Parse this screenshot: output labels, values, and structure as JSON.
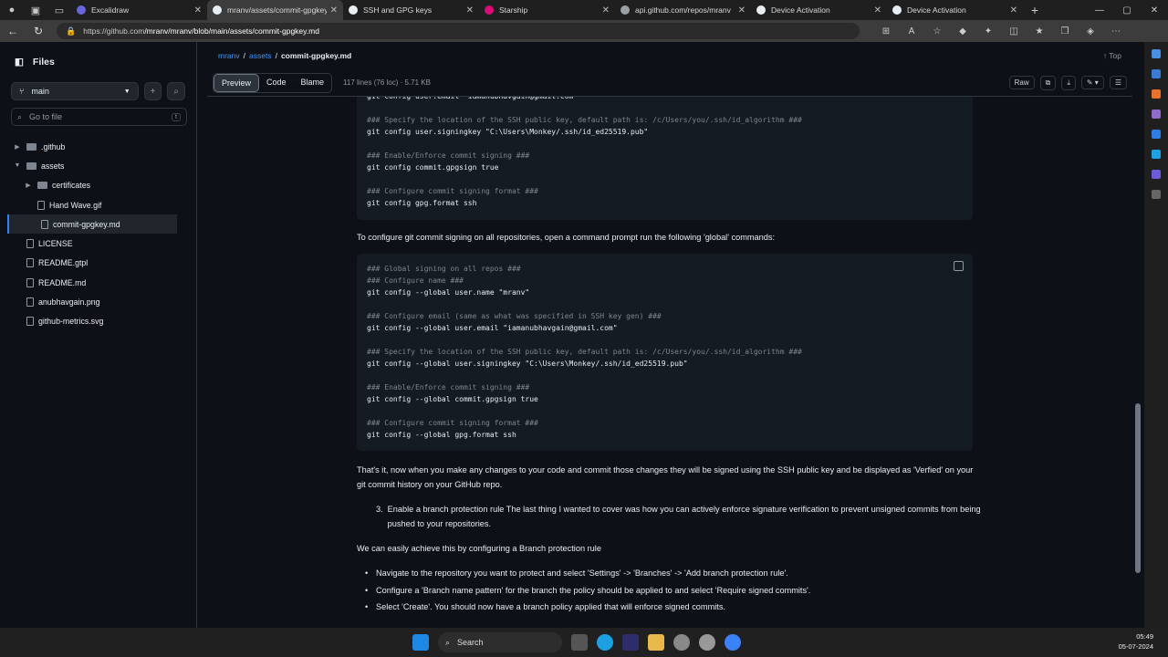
{
  "browser": {
    "tabs": [
      {
        "title": "Excalidraw",
        "color": "#6965db"
      },
      {
        "title": "mranv/assets/commit-gpgkey",
        "color": "#e6edf3",
        "active": true
      },
      {
        "title": "SSH and GPG keys",
        "color": "#e6edf3"
      },
      {
        "title": "Starship",
        "color": "#dd0b78"
      },
      {
        "title": "api.github.com/repos/mranv",
        "color": "#9aa0a6"
      },
      {
        "title": "Device Activation",
        "color": "#e6edf3"
      },
      {
        "title": "Device Activation",
        "color": "#e6edf3"
      }
    ],
    "url_prefix": "https://github.com",
    "url_path": "/mranv/mranv/blob/main/assets/commit-gpgkey.md"
  },
  "sidebar": {
    "title": "Files",
    "branch": "main",
    "goto_placeholder": "Go to file",
    "goto_kbd": "t",
    "tree": [
      {
        "label": ".github",
        "type": "folder",
        "depth": 0,
        "expand": "›"
      },
      {
        "label": "assets",
        "type": "folder",
        "depth": 0,
        "expand": "⌄"
      },
      {
        "label": "certificates",
        "type": "folder",
        "depth": 1,
        "expand": "›"
      },
      {
        "label": "Hand Wave.gif",
        "type": "file",
        "depth": 1
      },
      {
        "label": "commit-gpgkey.md",
        "type": "file",
        "depth": 1,
        "selected": true
      },
      {
        "label": "LICENSE",
        "type": "file",
        "depth": 0
      },
      {
        "label": "README.gtpl",
        "type": "file",
        "depth": 0
      },
      {
        "label": "README.md",
        "type": "file",
        "depth": 0
      },
      {
        "label": "anubhavgain.png",
        "type": "file",
        "depth": 0
      },
      {
        "label": "github-metrics.svg",
        "type": "file",
        "depth": 0
      }
    ]
  },
  "breadcrumb": {
    "owner": "mranv",
    "folder": "assets",
    "file": "commit-gpgkey.md",
    "top": "Top"
  },
  "filebar": {
    "tabs": [
      "Preview",
      "Code",
      "Blame"
    ],
    "meta": "117 lines (76 loc) · 5.71 KB",
    "raw": "Raw"
  },
  "code1": [
    {
      "t": "cmd",
      "s": "git config user.email \"iamanubhavgain@gmail.com\""
    },
    {
      "t": "blank",
      "s": ""
    },
    {
      "t": "cm",
      "s": "### Specify the location of the SSH public key, default path is: /c/Users/you/.ssh/id_algorithm ###"
    },
    {
      "t": "cmd",
      "s": "git config user.signingkey \"C:\\Users\\Monkey/.ssh/id_ed25519.pub\""
    },
    {
      "t": "blank",
      "s": ""
    },
    {
      "t": "cm",
      "s": "### Enable/Enforce commit signing ###"
    },
    {
      "t": "cmd",
      "s": "git config commit.gpgsign true"
    },
    {
      "t": "blank",
      "s": ""
    },
    {
      "t": "cm",
      "s": "### Configure commit signing format ###"
    },
    {
      "t": "cmd",
      "s": "git config gpg.format ssh"
    }
  ],
  "para_global": "To configure git commit signing on all repositories, open a command prompt run the following 'global' commands:",
  "code2": [
    {
      "t": "cm",
      "s": "### Global signing on all repos ###"
    },
    {
      "t": "cm",
      "s": "### Configure name ###"
    },
    {
      "t": "cmd",
      "s": "git config --global user.name \"mranv\""
    },
    {
      "t": "blank",
      "s": ""
    },
    {
      "t": "cm",
      "s": "### Configure email (same as what was specified in SSH key gen) ###"
    },
    {
      "t": "cmd",
      "s": "git config --global user.email \"iamanubhavgain@gmail.com\""
    },
    {
      "t": "blank",
      "s": ""
    },
    {
      "t": "cm",
      "s": "### Specify the location of the SSH public key, default path is: /c/Users/you/.ssh/id_algorithm ###"
    },
    {
      "t": "cmd",
      "s": "git config --global user.signingkey \"C:\\Users\\Monkey/.ssh/id_ed25519.pub\""
    },
    {
      "t": "blank",
      "s": ""
    },
    {
      "t": "cm",
      "s": "### Enable/Enforce commit signing ###"
    },
    {
      "t": "cmd",
      "s": "git config --global commit.gpgsign true"
    },
    {
      "t": "blank",
      "s": ""
    },
    {
      "t": "cm",
      "s": "### Configure commit signing format ###"
    },
    {
      "t": "cmd",
      "s": "git config --global gpg.format ssh"
    }
  ],
  "para_done": "That's it, now when you make any changes to your code and commit those changes they will be signed using the SSH public key and be displayed as 'Verfied' on your git commit history on your GitHub repo.",
  "step3_num": "3.",
  "step3": "Enable a branch protection rule The last thing I wanted to cover was how you can actively enforce signature verification to prevent unsigned commits from being pushed to your repositories.",
  "para_achieve": "We can easily achieve this by configuring a Branch protection rule",
  "bullets": [
    "Navigate to the repository you want to protect and select 'Settings' -> 'Branches' -> 'Add branch protection rule'.",
    "Configure a 'Branch name pattern' for the branch the policy should be applied to and select 'Require signed commits'.",
    "Select 'Create'. You should now have a branch policy applied that will enforce signed commits."
  ],
  "taskbar": {
    "search": "Search",
    "time": "05:49",
    "date": "05-07-2024"
  }
}
